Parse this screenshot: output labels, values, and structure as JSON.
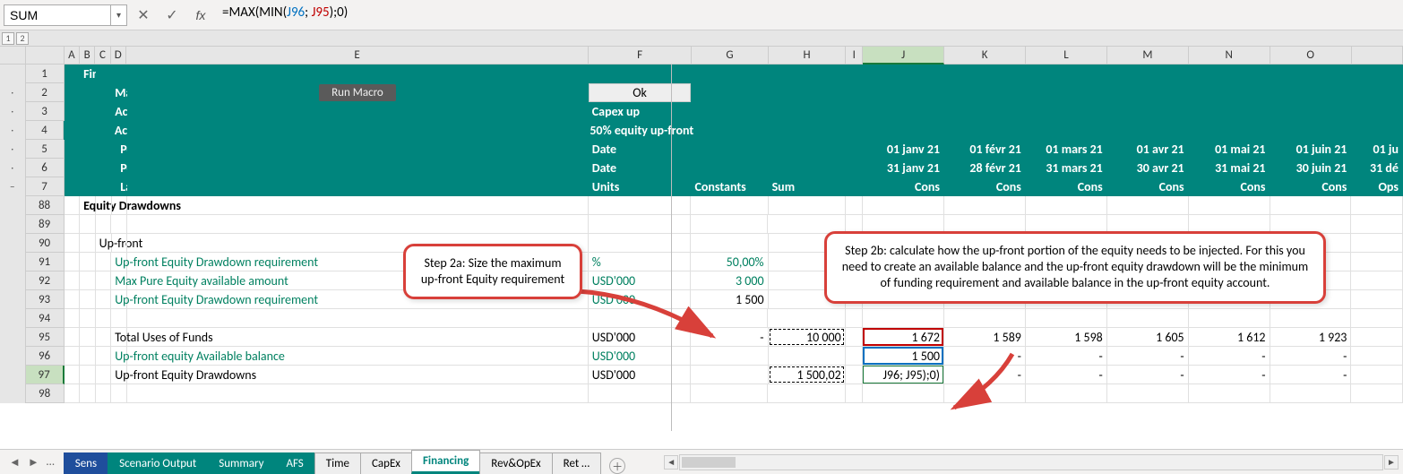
{
  "formula_bar": {
    "name_box": "SUM",
    "formula_plain": "=MAX(MIN(J96; J95);0)",
    "cancel_tip": "Cancel",
    "enter_tip": "Enter",
    "fx_tip": "Insert Function"
  },
  "outline": {
    "lvl1": "1",
    "lvl2": "2"
  },
  "columns": [
    "A",
    "B",
    "C",
    "D",
    "E",
    "F",
    "G",
    "H",
    "I",
    "J",
    "K",
    "L",
    "M",
    "N",
    "O"
  ],
  "col_tail": "01 ju",
  "rows_header": [
    "1",
    "2",
    "3",
    "4",
    "5",
    "6",
    "7",
    "88",
    "89",
    "90",
    "91",
    "92",
    "93",
    "94",
    "95",
    "96",
    "97",
    "98"
  ],
  "header": {
    "section": "Financing",
    "master_error": "Master error check",
    "run_macro": "Run Macro",
    "ok": "Ok",
    "active_sens": "Active Sensitivity Scenario",
    "capex_up": "Capex up",
    "active_input": "Active Input Scenario",
    "equity50": "50% equity up-front",
    "pbd": "Period beginning date",
    "ped": "Period ending date",
    "date": "Date",
    "label": "Label",
    "units": "Units",
    "constants": "Constants",
    "sum": "Sum",
    "begin_dates": [
      "01 janv 21",
      "01 févr 21",
      "01 mars 21",
      "01 avr 21",
      "01 mai 21",
      "01 juin 21"
    ],
    "end_dates": [
      "31 janv 21",
      "28 févr 21",
      "31 mars 21",
      "30 avr 21",
      "31 mai 21",
      "30 juin 21"
    ],
    "end_tail": "31 dé",
    "labels": [
      "Cons",
      "Cons",
      "Cons",
      "Cons",
      "Cons",
      "Cons"
    ],
    "labels_tail": "Ops"
  },
  "body": {
    "equity_drawdowns": "Equity  Drawdowns",
    "upfront": "Up-front",
    "r91": {
      "label": "Up-front Equity Drawdown requirement",
      "unit": "%",
      "g": "50,00%"
    },
    "r92": {
      "label": "Max Pure Equity available amount",
      "unit": "USD'000",
      "g": "3 000"
    },
    "r93": {
      "label": "Up-front Equity Drawdown requirement",
      "unit": "USD'000",
      "g": "1 500"
    },
    "r95": {
      "label": "Total Uses of Funds",
      "unit": "USD'000",
      "g": "-",
      "h": "10 000",
      "j": "1 672",
      "k": "1 589",
      "l": "1 598",
      "m": "1 605",
      "n": "1 612",
      "o": "1 923"
    },
    "r96": {
      "label": "Up-front equity  Available balance",
      "unit": "USD'000",
      "j": "1 500",
      "k": "-",
      "l": "-",
      "m": "-",
      "n": "-",
      "o": "-"
    },
    "r97": {
      "label": "Up-front  Equity  Drawdowns",
      "unit": "USD'000",
      "h": "1 500,02",
      "j": "J96; J95);0)",
      "k": "-",
      "l": "-",
      "m": "-",
      "n": "-",
      "o": "-"
    }
  },
  "callouts": {
    "step2a": "Step 2a: Size the maximum up-front Equity requirement",
    "step2b": "Step 2b: calculate how the up-front portion of the equity needs to be injected. For this you need to create an available balance and the up-front equity drawdown will be the minimum of funding requirement and available balance in the up-front equity account."
  },
  "tabs": {
    "nav_prev": "◄",
    "nav_next": "►",
    "more": "…",
    "sens": "Sens",
    "scenario": "Scenario Output",
    "summary": "Summary",
    "afs": "AFS",
    "time": "Time",
    "capex": "CapEx",
    "financing": "Financing",
    "revopex": "Rev&OpEx",
    "ret": "Ret …",
    "add": "＋"
  }
}
